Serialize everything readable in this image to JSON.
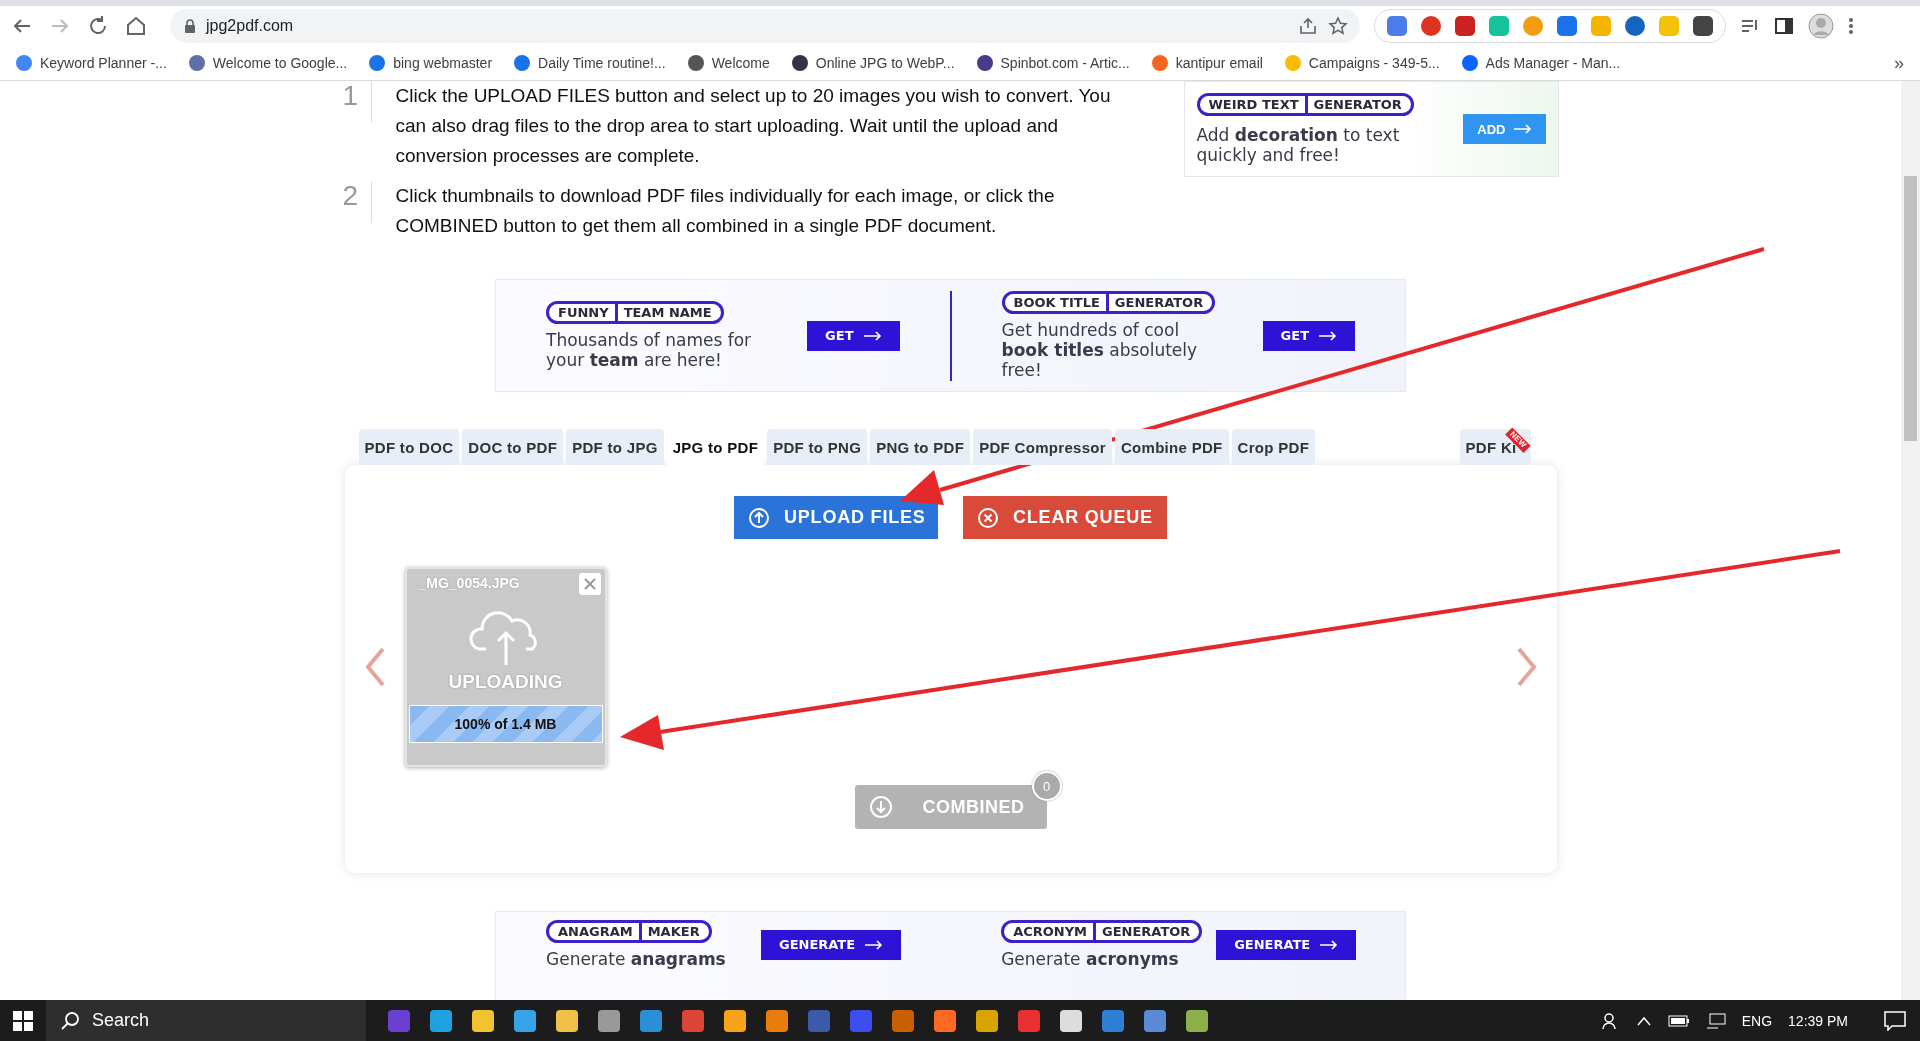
{
  "browser": {
    "url": "jpg2pdf.com",
    "bookmarks": [
      {
        "label": "Keyword Planner -..."
      },
      {
        "label": "Welcome to Google..."
      },
      {
        "label": "bing webmaster"
      },
      {
        "label": "Daily Time routine!..."
      },
      {
        "label": "Welcome"
      },
      {
        "label": "Online JPG to WebP..."
      },
      {
        "label": "Spinbot.com - Artic..."
      },
      {
        "label": "kantipur email"
      },
      {
        "label": "Campaigns - 349-5..."
      },
      {
        "label": "Ads Manager - Man..."
      }
    ],
    "more": "»"
  },
  "steps": [
    {
      "number": "1",
      "text": "Click the UPLOAD FILES button and select up to 20 images you wish to convert. You can also drag files to the drop area to start uploading. Wait until the upload and conversion processes are complete."
    },
    {
      "number": "2",
      "text": "Click thumbnails to download PDF files individually for each image, or click the COMBINED button to get them all combined in a single PDF document."
    }
  ],
  "side_ad": {
    "tag_left": "WEIRD TEXT",
    "tag_right": "GENERATOR",
    "text": "Add **decoration** to text quickly and free!",
    "button": "ADD"
  },
  "ad_banner": {
    "items": [
      {
        "tag_left": "FUNNY",
        "tag_right": "TEAM NAME",
        "text": "Thousands of names for your **team** are here!",
        "button": "GET"
      },
      {
        "tag_left": "BOOK TITLE",
        "tag_right": "GENERATOR",
        "text": "Get hundreds of cool **book titles** absolutely free!",
        "button": "GET"
      }
    ]
  },
  "tabs": [
    {
      "label": "PDF to DOC",
      "selected": false
    },
    {
      "label": "DOC to PDF",
      "selected": false
    },
    {
      "label": "PDF to JPG",
      "selected": false
    },
    {
      "label": "JPG to PDF",
      "selected": true
    },
    {
      "label": "PDF to PNG",
      "selected": false
    },
    {
      "label": "PNG to PDF",
      "selected": false
    },
    {
      "label": "PDF Compressor",
      "selected": false
    },
    {
      "label": "Combine PDF",
      "selected": false
    },
    {
      "label": "Crop PDF",
      "selected": false
    },
    {
      "label": "PDF Ki",
      "selected": false,
      "badge": "NEW"
    }
  ],
  "upload_button": "UPLOAD FILES",
  "clear_button": "CLEAR QUEUE",
  "files": [
    {
      "name": "_MG_0054.JPG",
      "status": "UPLOADING",
      "progress": "100% of 1.4 MB",
      "level": 1
    }
  ],
  "combined": {
    "label": "COMBINED",
    "count": "0",
    "disabled": true
  },
  "bottom_ad": {
    "items": [
      {
        "tag_left": "ANAGRAM",
        "tag_right": "MAKER",
        "text": "Generate **anagrams**",
        "button": "GENERATE"
      },
      {
        "tag_left": "ACRONYM",
        "tag_right": "GENERATOR",
        "text": "Generate **acronyms**",
        "button": "GENERATE"
      }
    ]
  },
  "taskbar": {
    "search": "Search",
    "language": "ENG",
    "time": "12:39 PM"
  }
}
